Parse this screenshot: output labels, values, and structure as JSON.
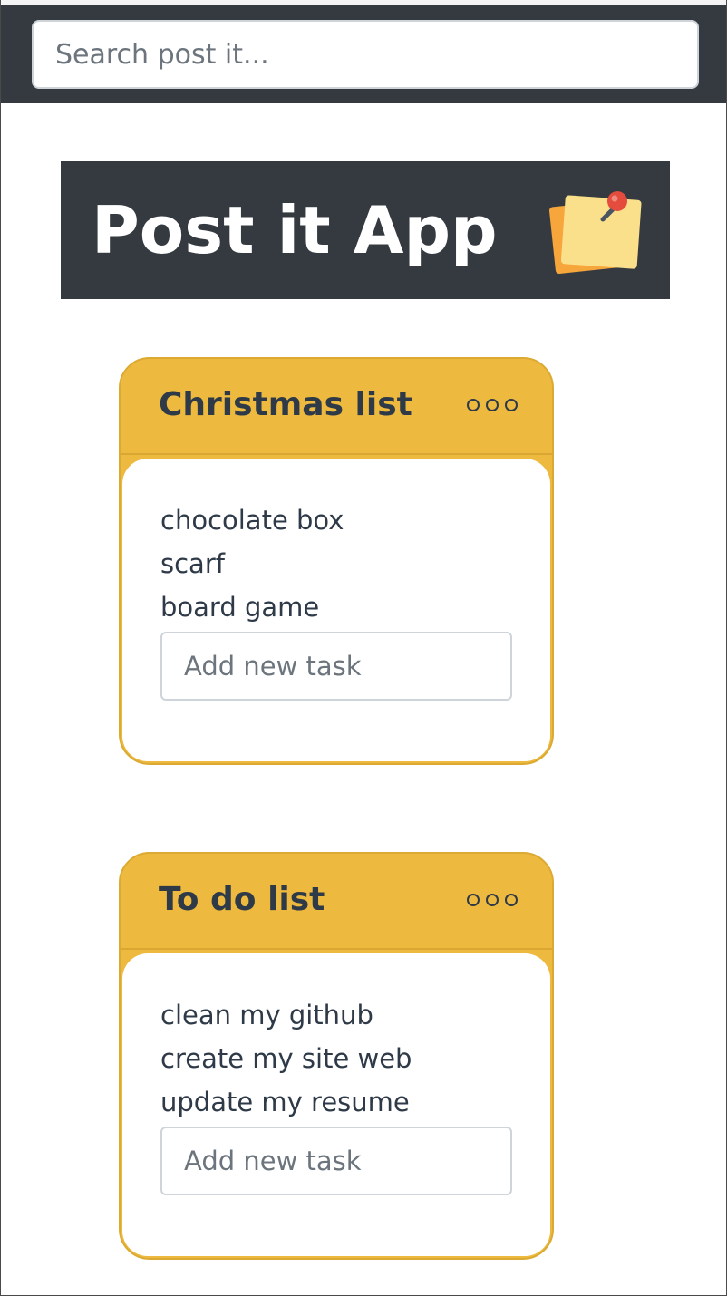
{
  "search": {
    "placeholder": "Search post it..."
  },
  "banner": {
    "title": "Post it App",
    "logo_icon": "sticky-note-pin-icon"
  },
  "colors": {
    "dark": "#343a40",
    "card_yellow": "#edb93f",
    "card_border": "#dcaa33",
    "text_dark": "#2f3a48",
    "pin_red": "#e44c3d"
  },
  "lists": [
    {
      "title": "Christmas list",
      "menu_icon": "more-options-icon",
      "tasks": [
        "chocolate box",
        "scarf",
        "board game"
      ],
      "new_task_placeholder": "Add new task"
    },
    {
      "title": "To do list",
      "menu_icon": "more-options-icon",
      "tasks": [
        "clean my github",
        "create my site web",
        "update my resume"
      ],
      "new_task_placeholder": "Add new task"
    }
  ]
}
